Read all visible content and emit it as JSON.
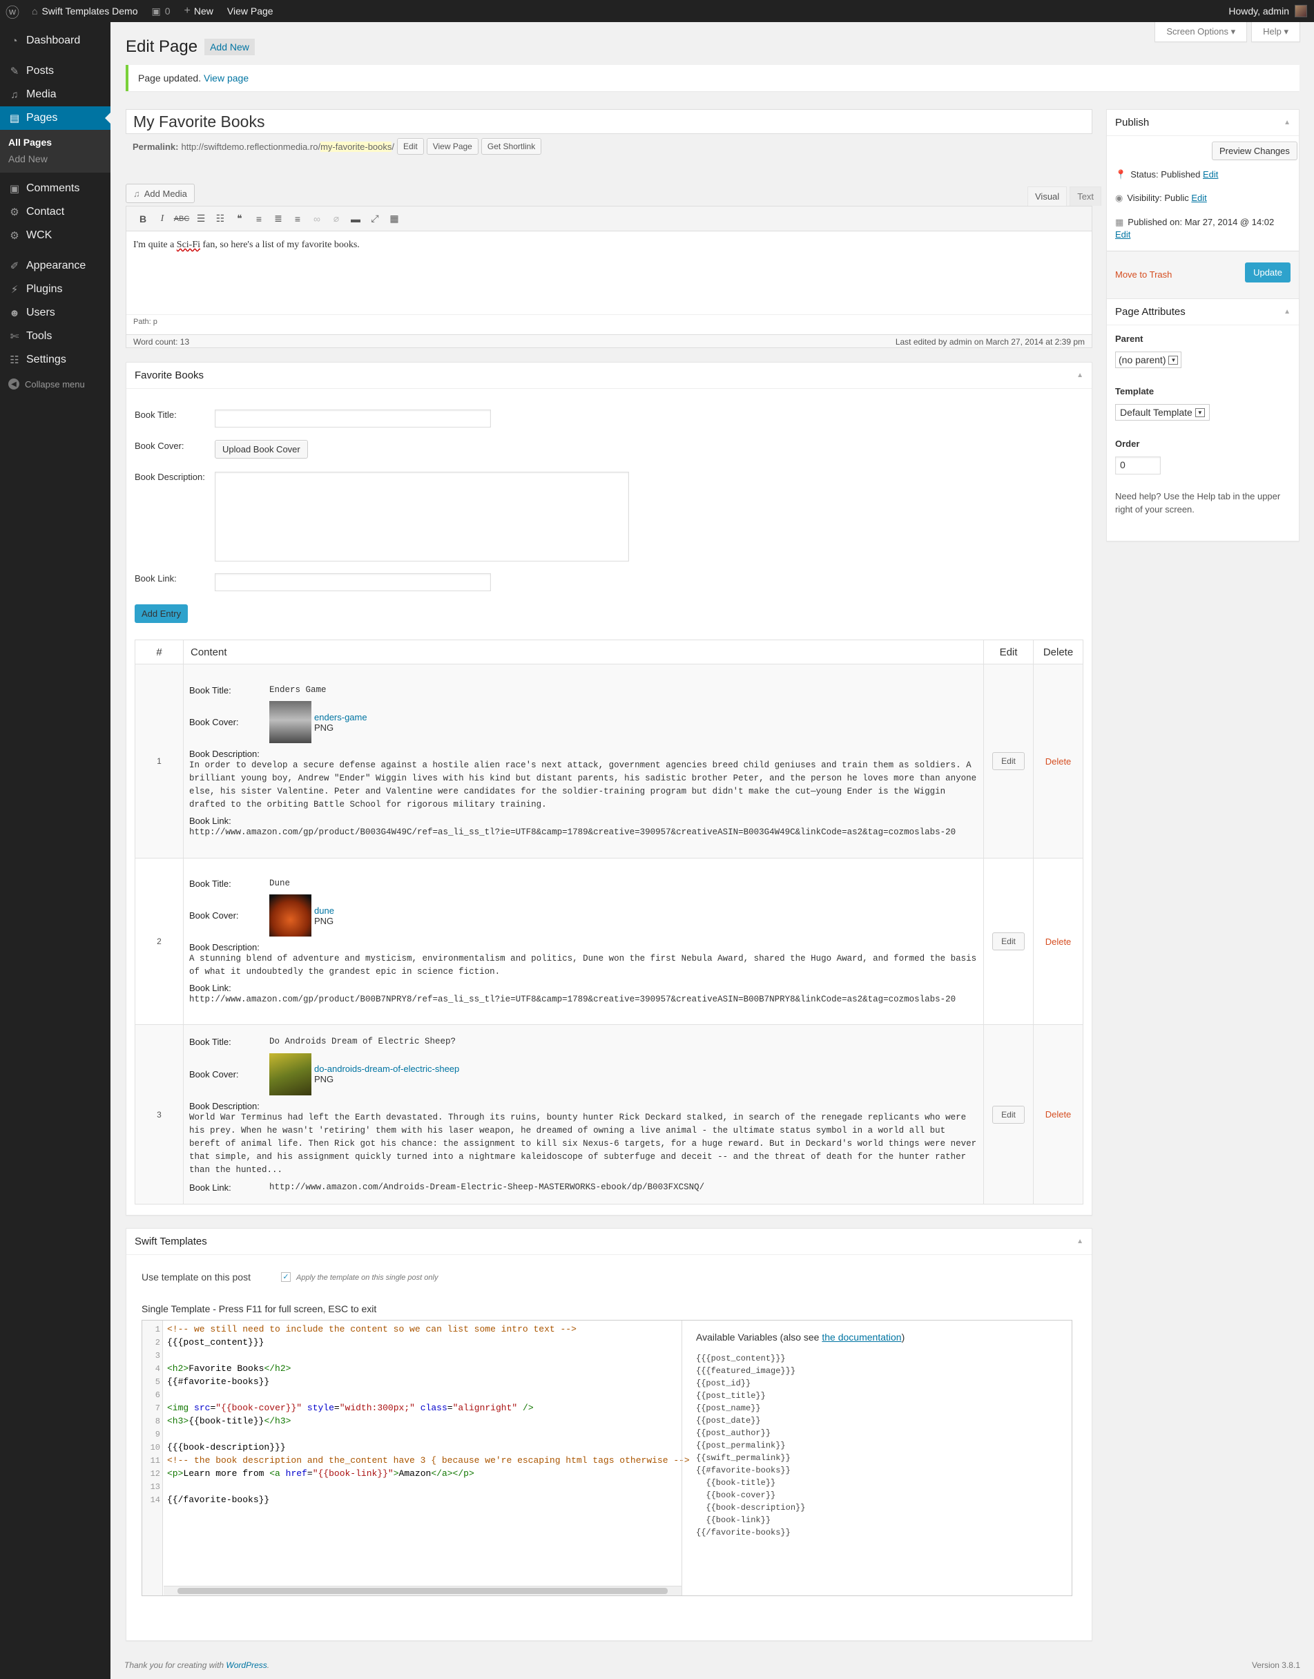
{
  "adminbar": {
    "site_name": "Swift Templates Demo",
    "comments_count": "0",
    "new_label": "New",
    "view_page": "View Page",
    "howdy": "Howdy, admin"
  },
  "menu": {
    "items": [
      {
        "label": "Dashboard",
        "icon": "dashboard-icon"
      },
      {
        "label": "Posts",
        "icon": "pin-icon"
      },
      {
        "label": "Media",
        "icon": "media-icon"
      },
      {
        "label": "Pages",
        "icon": "pages-icon"
      },
      {
        "label": "Comments",
        "icon": "comment-icon"
      },
      {
        "label": "Contact",
        "icon": "gear-icon"
      },
      {
        "label": "WCK",
        "icon": "gear-icon"
      },
      {
        "label": "Appearance",
        "icon": "brush-icon"
      },
      {
        "label": "Plugins",
        "icon": "plug-icon"
      },
      {
        "label": "Users",
        "icon": "user-icon"
      },
      {
        "label": "Tools",
        "icon": "wrench-icon"
      },
      {
        "label": "Settings",
        "icon": "settings-icon"
      }
    ],
    "sub_all_pages": "All Pages",
    "sub_add_new": "Add New",
    "collapse": "Collapse menu"
  },
  "header": {
    "screen_options": "Screen Options ▾",
    "help": "Help ▾",
    "title": "Edit Page",
    "add_new": "Add New"
  },
  "notice": {
    "text": "Page updated.",
    "link": "View page"
  },
  "post": {
    "title": "My Favorite Books",
    "permalink_label": "Permalink:",
    "permalink_base": "http://swiftdemo.reflectionmedia.ro/",
    "permalink_slug": "my-favorite-books",
    "permalink_end": "/",
    "btn_edit": "Edit",
    "btn_view": "View Page",
    "btn_shortlink": "Get Shortlink",
    "add_media": "Add Media",
    "tab_visual": "Visual",
    "tab_text": "Text",
    "content_before": "I'm quite a ",
    "content_sq": "Sci-Fi",
    "content_after": " fan, so here's a list of my favorite books.",
    "path": "Path: p",
    "word_count": "Word count: 13",
    "last_edited": "Last edited by admin on March 27, 2014 at 2:39 pm"
  },
  "favorite_books": {
    "title": "Favorite Books",
    "label_title": "Book Title:",
    "label_cover": "Book Cover:",
    "label_desc": "Book Description:",
    "label_link": "Book Link:",
    "upload_btn": "Upload Book Cover",
    "add_entry": "Add Entry",
    "col_num": "#",
    "col_content": "Content",
    "col_edit": "Edit",
    "col_delete": "Delete",
    "edit": "Edit",
    "delete": "Delete",
    "entries": [
      {
        "num": "1",
        "title": "Enders Game",
        "cover_name": "enders-game",
        "cover_type": "PNG",
        "cover_color": "#8a8a8a",
        "description": "In order to develop a secure defense against a hostile alien race's next attack, government agencies breed child geniuses and train them as soldiers. A brilliant young boy, Andrew \"Ender\" Wiggin lives with his kind but distant parents, his sadistic brother Peter, and the person he loves more than anyone else, his sister Valentine. Peter and Valentine were candidates for the soldier-training program but didn't make the cut—young Ender is the Wiggin drafted to the orbiting Battle School for rigorous military training.",
        "link": "http://www.amazon.com/gp/product/B003G4W49C/ref=as_li_ss_tl?ie=UTF8&camp=1789&creative=390957&creativeASIN=B003G4W49C&linkCode=as2&tag=cozmoslabs-20"
      },
      {
        "num": "2",
        "title": "Dune",
        "cover_name": "dune",
        "cover_type": "PNG",
        "cover_color": "#b23a10",
        "description": "A stunning blend of adventure and mysticism, environmentalism and politics, Dune won the first Nebula Award, shared the Hugo Award, and formed the basis of what it undoubtedly the grandest epic in science fiction.",
        "link": "http://www.amazon.com/gp/product/B00B7NPRY8/ref=as_li_ss_tl?ie=UTF8&camp=1789&creative=390957&creativeASIN=B00B7NPRY8&linkCode=as2&tag=cozmoslabs-20"
      },
      {
        "num": "3",
        "title": "Do Androids Dream of Electric Sheep?",
        "cover_name": "do-androids-dream-of-electric-sheep",
        "cover_type": "PNG",
        "cover_color": "#8a8a24",
        "description": "World War Terminus had left the Earth devastated. Through its ruins, bounty hunter Rick Deckard stalked, in search of the renegade replicants who were his prey. When he wasn't 'retiring' them with his laser weapon, he dreamed of owning a live animal - the ultimate status symbol in a world all but bereft of animal life. Then Rick got his chance: the assignment to kill six Nexus-6 targets, for a huge reward. But in Deckard's world things were never that simple, and his assignment quickly turned into a nightmare kaleidoscope of subterfuge and deceit -- and the threat of death for the hunter rather than the hunted...",
        "link": "http://www.amazon.com/Androids-Dream-Electric-Sheep-MASTERWORKS-ebook/dp/B003FXCSNQ/"
      }
    ]
  },
  "swift": {
    "title": "Swift Templates",
    "use_template": "Use template on this post",
    "apply_note": "Apply the template on this single post only",
    "single_template": "Single Template - Press F11 for full screen, ESC to exit",
    "vars_heading": "Available Variables (also see ",
    "vars_link": "the documentation",
    "vars_close": ")",
    "code_lines": [
      "1",
      "2",
      "3",
      "4",
      "5",
      "6",
      "7",
      "8",
      "9",
      "10",
      "11",
      "12",
      "13",
      "14"
    ],
    "variables": "{{{post_content}}}\n{{{featured_image}}}\n{{post_id}}\n{{post_title}}\n{{post_name}}\n{{post_date}}\n{{post_author}}\n{{post_permalink}}\n{{swift_permalink}}\n{{#favorite-books}}\n  {{book-title}}\n  {{book-cover}}\n  {{book-description}}\n  {{book-link}}\n{{/favorite-books}}"
  },
  "publish": {
    "title": "Publish",
    "preview": "Preview Changes",
    "status_label": "Status:",
    "status_value": "Published",
    "visibility_label": "Visibility:",
    "visibility_value": "Public",
    "published_label": "Published on:",
    "published_value": "Mar 27, 2014 @ 14:02",
    "edit": "Edit",
    "trash": "Move to Trash",
    "update": "Update"
  },
  "attributes": {
    "title": "Page Attributes",
    "parent_label": "Parent",
    "parent_value": "(no parent)",
    "template_label": "Template",
    "template_value": "Default Template",
    "order_label": "Order",
    "order_value": "0",
    "help": "Need help? Use the Help tab in the upper right of your screen."
  },
  "footer": {
    "thanks": "Thank you for creating with ",
    "wp": "WordPress",
    "dot": ".",
    "version": "Version 3.8.1"
  }
}
